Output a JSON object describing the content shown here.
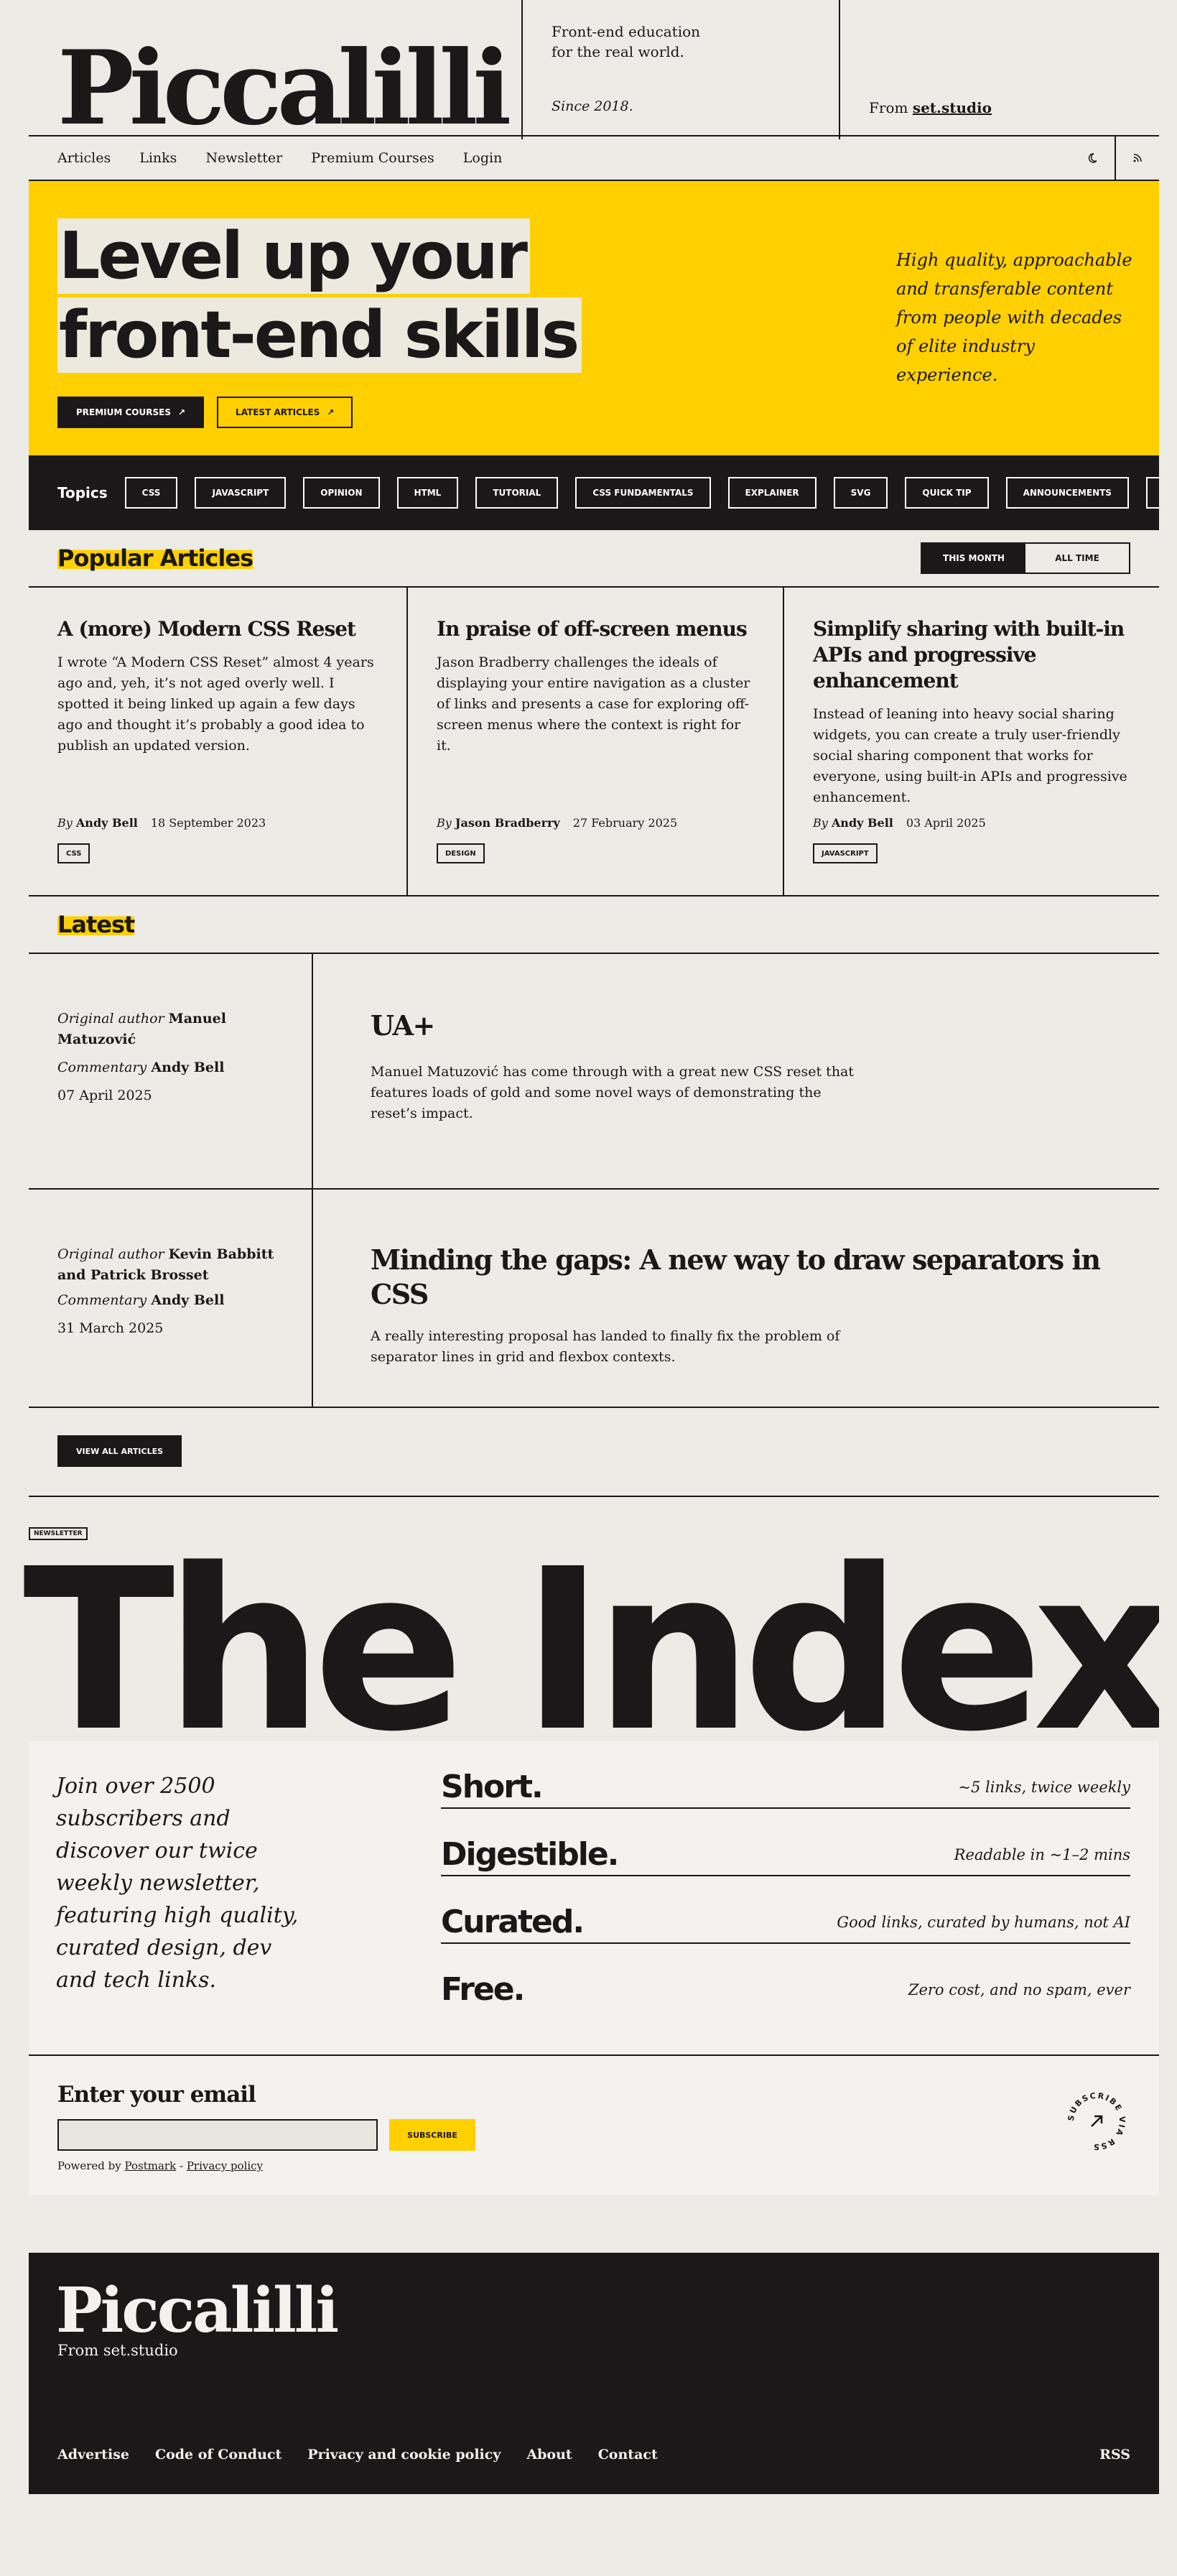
{
  "header": {
    "logo": "Piccalilli",
    "tagline": "Front-end education for the real world.",
    "since": "Since 2018.",
    "from_prefix": "From",
    "from_link": "set.studio"
  },
  "nav": {
    "items": [
      "Articles",
      "Links",
      "Newsletter",
      "Premium Courses",
      "Login"
    ],
    "icons": [
      "moon-icon",
      "rss-icon"
    ]
  },
  "hero": {
    "title_line1": "Level up your",
    "title_line2": "front-end skills",
    "primary_button": "Premium courses",
    "secondary_button": "Latest articles",
    "blurb": "High quality, approachable and transferable content from people with decades of elite industry experience."
  },
  "topics": {
    "label": "Topics",
    "items": [
      "CSS",
      "JAVASCRIPT",
      "OPINION",
      "HTML",
      "TUTORIAL",
      "CSS FUNDAMENTALS",
      "EXPLAINER",
      "SVG",
      "QUICK TIP",
      "ANNOUNCEMENTS"
    ]
  },
  "popular": {
    "heading": "Popular Articles",
    "toggle": [
      "THIS MONTH",
      "ALL TIME"
    ],
    "articles": [
      {
        "title": "A (more) Modern CSS Reset",
        "excerpt": "I wrote “A Modern CSS Reset” almost 4 years ago and, yeh, it’s not aged overly well. I spotted it being linked up again a few days ago and thought it’s probably a good idea to publish an updated version.",
        "by": "By",
        "author": "Andy Bell",
        "date": "18 September 2023",
        "tag": "CSS"
      },
      {
        "title": "In praise of off-screen menus",
        "excerpt": "Jason Bradberry challenges the ideals of displaying your entire navigation as a cluster of links and presents a case for exploring off-screen menus where the context is right for it.",
        "by": "By",
        "author": "Jason Bradberry",
        "date": "27 February 2025",
        "tag": "DESIGN"
      },
      {
        "title": "Simplify sharing with built-in APIs and progressive enhancement",
        "excerpt": "Instead of leaning into heavy social sharing widgets, you can create a truly user-friendly social sharing component that works for everyone, using built-in APIs and progressive enhancement.",
        "by": "By",
        "author": "Andy Bell",
        "date": "03 April 2025",
        "tag": "JAVASCRIPT"
      }
    ]
  },
  "latest": {
    "heading": "Latest",
    "items": [
      {
        "orig_label": "Original author",
        "orig_author": "Manuel Matuzović",
        "comm_label": "Commentary",
        "comm_author": "Andy Bell",
        "date": "07 April 2025",
        "title": "UA+",
        "excerpt": "Manuel Matuzović has come through with a great new CSS reset that features loads of gold and some novel ways of demonstrating the reset’s impact."
      },
      {
        "orig_label": "Original author",
        "orig_author": "Kevin Babbitt and Patrick Brosset",
        "comm_label": "Commentary",
        "comm_author": "Andy Bell",
        "date": "31 March 2025",
        "title": "Minding the gaps: A new way to draw separators in CSS",
        "excerpt": "A really interesting proposal has landed to finally fix the problem of separator lines in grid and flexbox contexts."
      }
    ],
    "view_all": "VIEW ALL ARTICLES"
  },
  "newsletter": {
    "badge": "NEWSLETTER",
    "title": "The Index",
    "intro": "Join over 2500 subscribers and discover our twice weekly newsletter, featuring high quality, curated design, dev and tech links.",
    "features": [
      {
        "title": "Short.",
        "desc": "~5 links, twice weekly"
      },
      {
        "title": "Digestible.",
        "desc": "Readable in ~1–2 mins"
      },
      {
        "title": "Curated.",
        "desc": "Good links, curated by humans, not AI"
      },
      {
        "title": "Free.",
        "desc": "Zero cost, and no spam, ever"
      }
    ],
    "email_label": "Enter your email",
    "email_value": "",
    "subscribe": "SUBSCRIBE",
    "powered_prefix": "Powered by",
    "powered_link": "Postmark",
    "separator": "-",
    "privacy_link": "Privacy policy",
    "rss_badge": "SUBSCRIBE VIA RSS"
  },
  "footer": {
    "logo": "Piccalilli",
    "sub": "From set.studio",
    "links": [
      "Advertise",
      "Code of Conduct",
      "Privacy and cookie policy",
      "About",
      "Contact"
    ],
    "rss": "RSS"
  }
}
